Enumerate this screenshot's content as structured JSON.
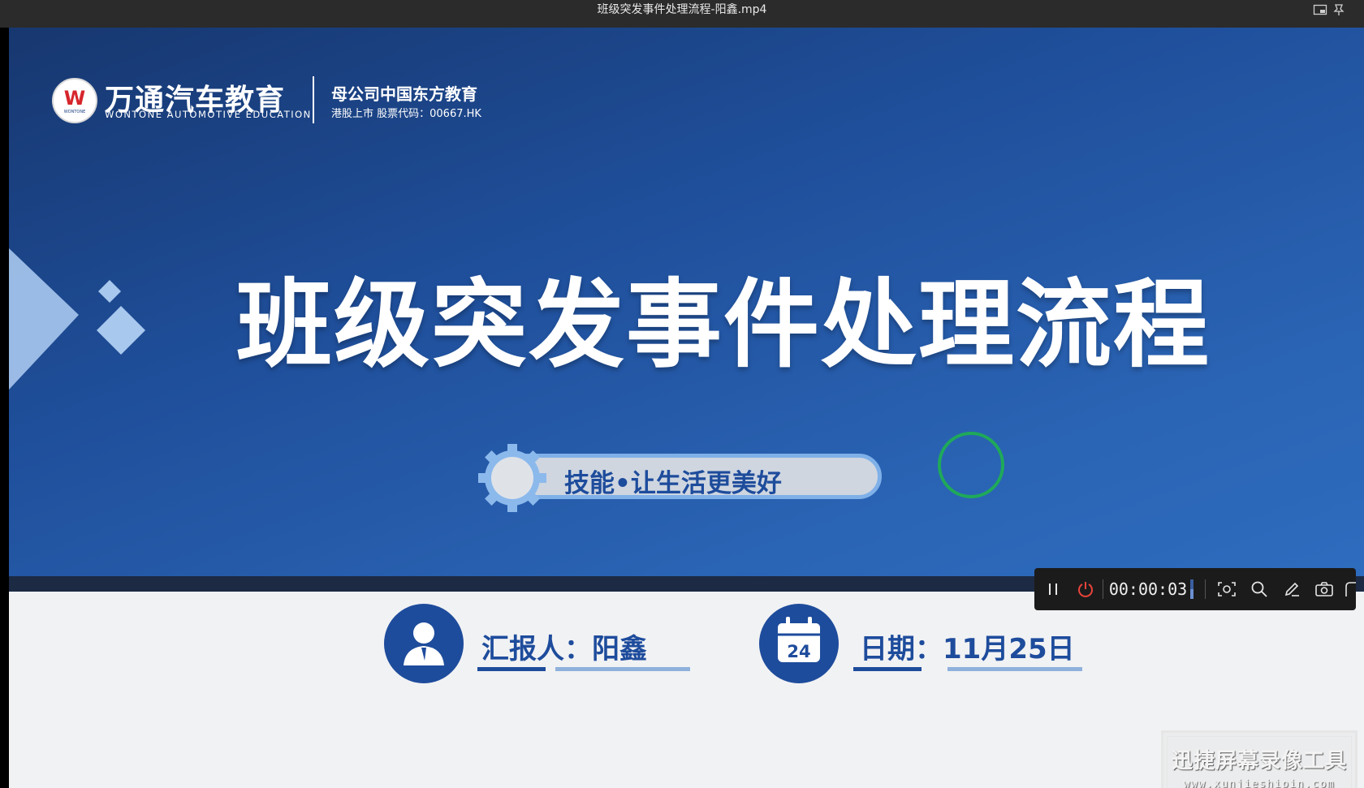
{
  "window": {
    "title": "班级突发事件处理流程-阳鑫.mp4",
    "icons": [
      "picture-in-picture-icon",
      "pin-icon"
    ]
  },
  "slide": {
    "logo_mark": "W",
    "logo_mark_sub": "WONTONE",
    "brand_cn": "万通汽车教育",
    "brand_en": "WONTONE AUTOMOTIVE EDUCATION",
    "parent_company": "母公司中国东方教育",
    "stock_info": "港股上市 股票代码：00667.HK",
    "main_title": "班级突发事件处理流程",
    "slogan": "技能•让生活更美好",
    "reporter_label": "汇报人：阳鑫",
    "date_label": "日期：11月25日",
    "calendar_day": "24",
    "colors": {
      "accent": "#1e4c9c",
      "slide_bg": "#2a63b3"
    }
  },
  "recorder": {
    "time": "00:00:03",
    "buttons": [
      "pause",
      "stop",
      "screenshot-region",
      "zoom",
      "annotate",
      "camera",
      "more"
    ]
  },
  "watermark": {
    "cn": "迅捷屏幕录像工具",
    "en": "www.xunjieshipin.com"
  }
}
